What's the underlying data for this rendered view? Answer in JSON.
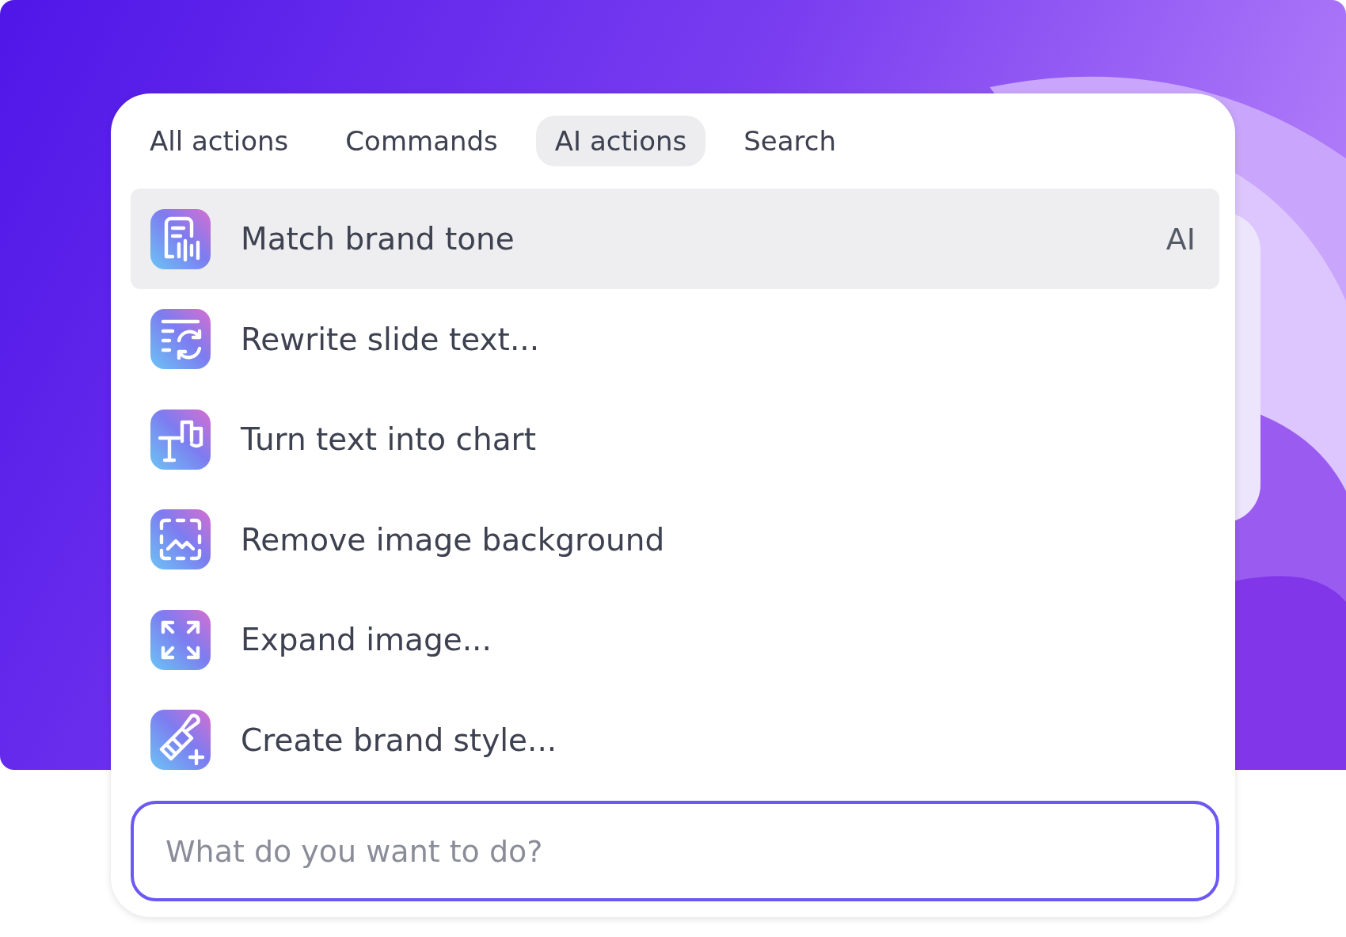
{
  "tabs": [
    {
      "label": "All actions",
      "selected": false
    },
    {
      "label": "Commands",
      "selected": false
    },
    {
      "label": "AI actions",
      "selected": true
    },
    {
      "label": "Search",
      "selected": false
    }
  ],
  "actions": [
    {
      "label": "Match brand tone",
      "selected": true,
      "badge": "AI"
    },
    {
      "label": "Rewrite slide text...",
      "selected": false
    },
    {
      "label": "Turn text into chart",
      "selected": false
    },
    {
      "label": "Remove image background",
      "selected": false
    },
    {
      "label": "Expand image...",
      "selected": false
    },
    {
      "label": "Create brand style...",
      "selected": false
    }
  ],
  "search": {
    "placeholder": "What do you want to do?"
  }
}
